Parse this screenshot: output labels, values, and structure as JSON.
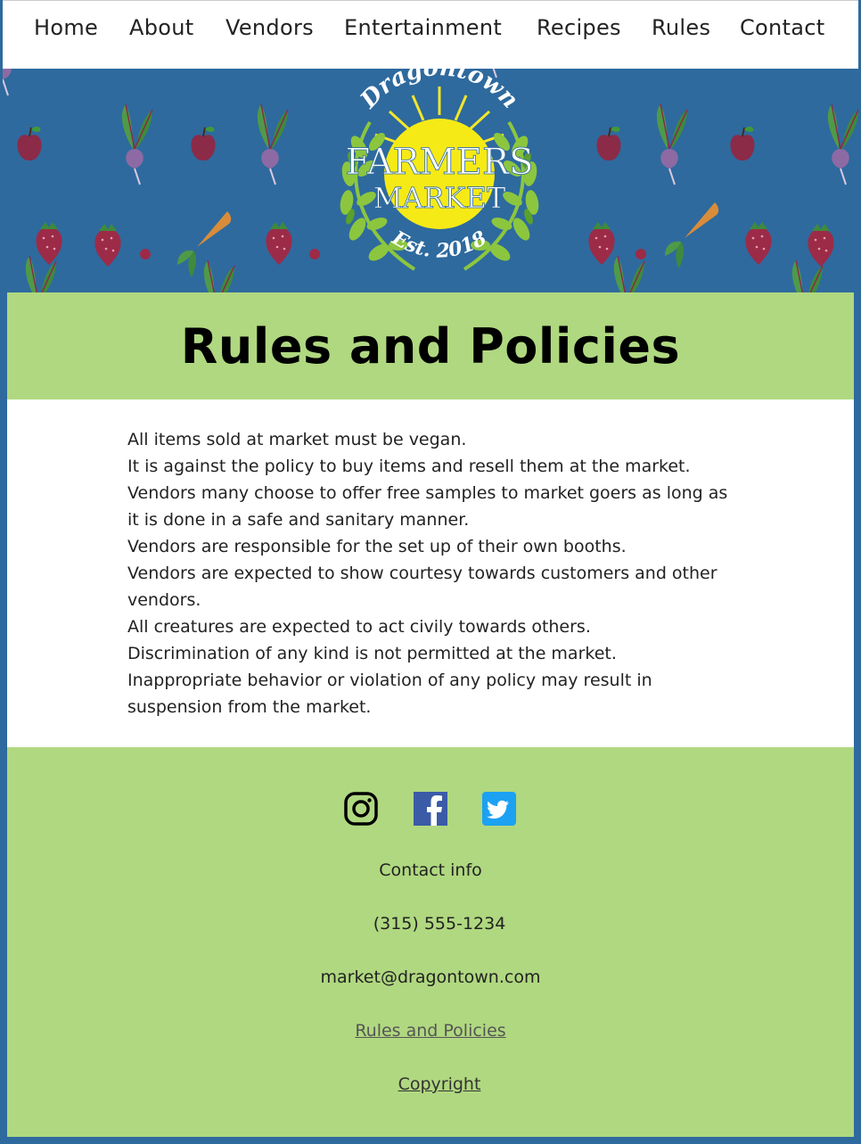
{
  "nav": {
    "items": [
      {
        "label": "Home"
      },
      {
        "label": "About"
      },
      {
        "label": "Vendors"
      },
      {
        "label": "Entertainment"
      },
      {
        "label": "Recipes"
      },
      {
        "label": "Rules"
      },
      {
        "label": "Contact"
      }
    ]
  },
  "logo": {
    "top_text": "Dragontown",
    "line1": "FARMERS",
    "line2": "MARKET",
    "est": "Est. 2018"
  },
  "page": {
    "title": "Rules and Policies"
  },
  "rules": [
    "All items sold at market must be vegan.",
    "It is against the policy to buy items and resell them at the market.",
    "Vendors many choose to offer free samples to market goers as long as it is done in a safe and sanitary manner.",
    "Vendors are responsible for the set up of their own booths.",
    "Vendors are expected to show courtesy towards customers and other vendors.",
    "All creatures are expected to act civily towards others.",
    "Discrimination of any kind is not permitted at the market.",
    "Inappropriate behavior or violation of any policy may result in suspension from the market."
  ],
  "footer": {
    "social": [
      "instagram-icon",
      "facebook-icon",
      "twitter-icon"
    ],
    "contact_label": "Contact info",
    "phone": "(315) 555-1234",
    "email": "market@dragontown.com",
    "rules_link": "Rules and Policies",
    "copyright_link": "Copyright"
  },
  "colors": {
    "nav_bg": "#ffffff",
    "banner_bg": "#2e6a9e",
    "accent_green": "#b0d880",
    "content_bg": "#ffffff"
  }
}
